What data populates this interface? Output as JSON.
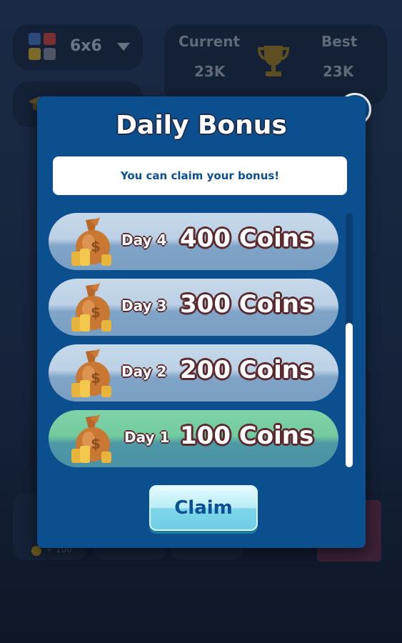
{
  "background": {
    "board_size": "6x6",
    "score": {
      "current_label": "Current",
      "current_value": "23K",
      "best_label": "Best",
      "best_value": "23K"
    },
    "bonus_amount": "+ 100"
  },
  "dialog": {
    "title": "Daily Bonus",
    "message": "You can claim your bonus!",
    "rewards": [
      {
        "day": "Day 4",
        "amount": "400 Coins",
        "active": false
      },
      {
        "day": "Day 3",
        "amount": "300 Coins",
        "active": false
      },
      {
        "day": "Day 2",
        "amount": "200 Coins",
        "active": false
      },
      {
        "day": "Day 1",
        "amount": "100 Coins",
        "active": true
      }
    ],
    "claim_label": "Claim",
    "close_icon": "close-icon"
  },
  "colors": {
    "dialog_bg": "#0c4f8f",
    "row_normal": "#c6d9ea",
    "row_active": "#7fd3a8",
    "claim_button": "#b8ecf6",
    "text_outline": "#5a2a2f"
  }
}
